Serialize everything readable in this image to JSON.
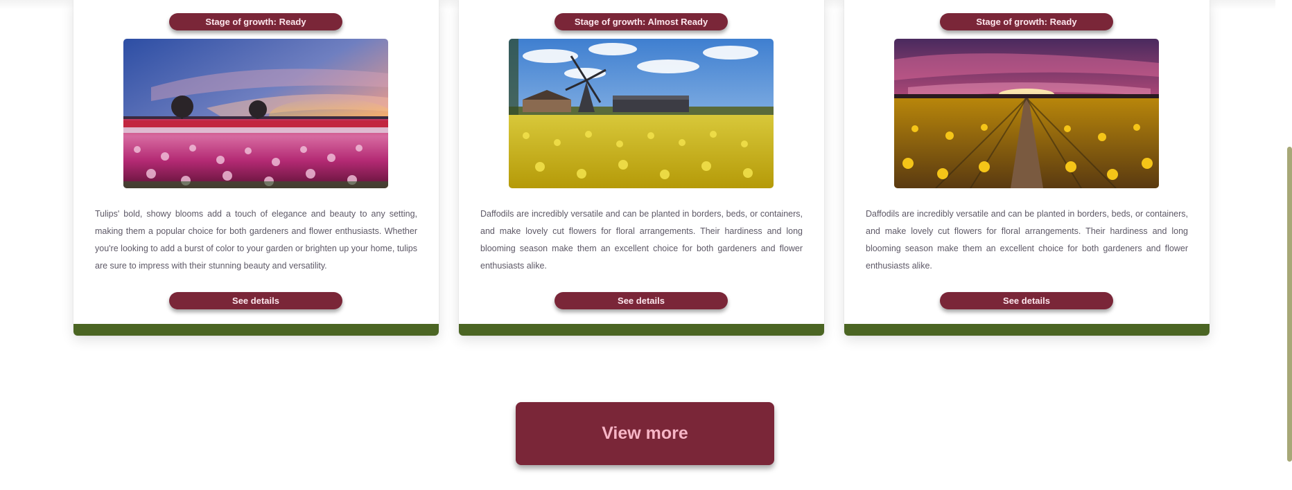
{
  "cards": [
    {
      "stage_label": "Stage of growth: Ready",
      "image": "tulip-field-sunset",
      "description": "Tulips' bold, showy blooms add a touch of elegance and beauty to any setting, making them a popular choice for both gardeners and flower enthusiasts. Whether you're looking to add a burst of color to your garden or brighten up your home, tulips are sure to impress with their stunning beauty and versatility.",
      "button_label": "See details"
    },
    {
      "stage_label": "Stage of growth: Almost Ready",
      "image": "daffodil-field-windmill",
      "description": "Daffodils are incredibly versatile and can be planted in borders, beds, or containers, and make lovely cut flowers for floral arrangements. Their hardiness and long blooming season make them an excellent choice for both gardeners and flower enthusiasts alike.",
      "button_label": "See details"
    },
    {
      "stage_label": "Stage of growth: Ready",
      "image": "daffodil-rows-sunset",
      "description": "Daffodils are incredibly versatile and can be planted in borders, beds, or containers, and make lovely cut flowers for floral arrangements. Their hardiness and long blooming season make them an excellent choice for both gardeners and flower enthusiasts alike.",
      "button_label": "See details"
    }
  ],
  "view_more_label": "View more",
  "colors": {
    "primary": "#7a2638",
    "button_text": "#fde7ee",
    "view_more_text": "#f7b5c6",
    "card_footer": "#4b6523",
    "scroll_thumb": "#a7a877",
    "body_text": "#5d5866"
  }
}
